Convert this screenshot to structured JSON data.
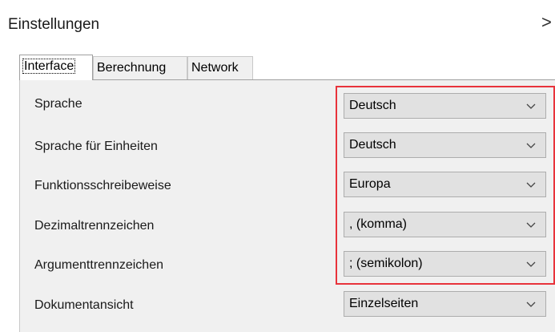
{
  "window": {
    "title": "Einstellungen",
    "close_symbol": ">"
  },
  "tabs": [
    {
      "label": "Interface",
      "active": true
    },
    {
      "label": "Berechnung",
      "active": false
    },
    {
      "label": "Network",
      "active": false
    }
  ],
  "settings": [
    {
      "label": "Sprache",
      "value": "Deutsch"
    },
    {
      "label": "Sprache für Einheiten",
      "value": "Deutsch"
    },
    {
      "label": "Funktionsschreibeweise",
      "value": "Europa"
    },
    {
      "label": "Dezimaltrennzeichen",
      "value": ", (komma)"
    },
    {
      "label": "Argumenttrennzeichen",
      "value": "; (semikolon)"
    },
    {
      "label": "Dokumentansicht",
      "value": "Einzelseiten"
    }
  ],
  "colors": {
    "highlight": "#e8333b",
    "panel": "#f0f0f0",
    "select_bg": "#e1e1e1"
  },
  "icons": {
    "dropdown": "chevron-down-icon",
    "close": "close-icon"
  }
}
